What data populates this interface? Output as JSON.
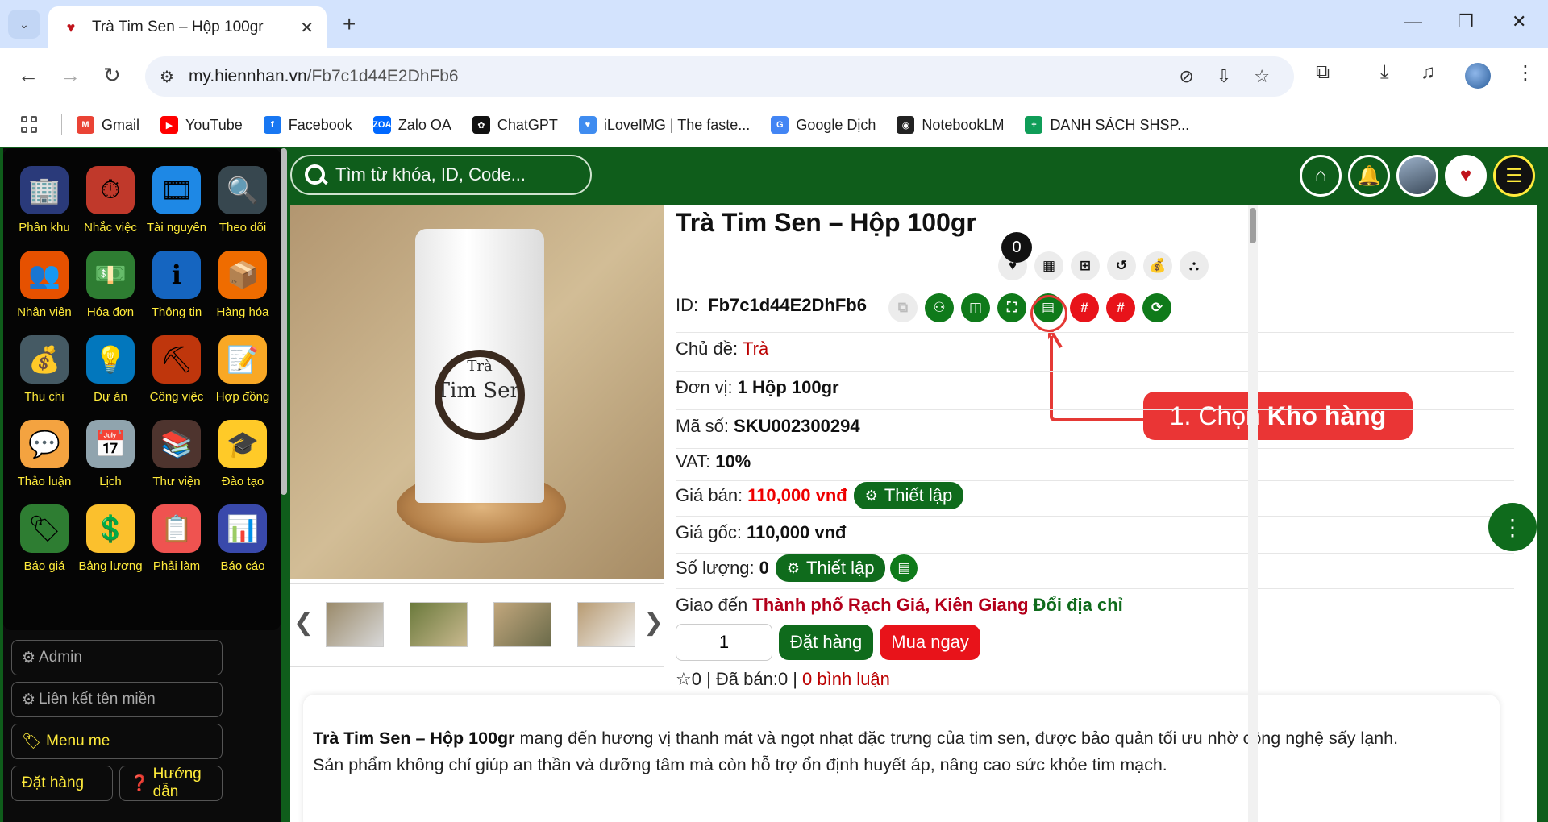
{
  "browser": {
    "tab_title": "Trà Tim Sen – Hộp 100gr",
    "url_domain": "my.hiennhan.vn",
    "url_path": "/Fb7c1d44E2DhFb6",
    "bookmarks": [
      {
        "label": "Gmail",
        "icon": "gmail-icon",
        "color": "#ea4335",
        "glyph": "M"
      },
      {
        "label": "YouTube",
        "icon": "youtube-icon",
        "color": "#ff0000",
        "glyph": "▶"
      },
      {
        "label": "Facebook",
        "icon": "facebook-icon",
        "color": "#1877f2",
        "glyph": "f"
      },
      {
        "label": "Zalo OA",
        "icon": "zalo-icon",
        "color": "#0068ff",
        "glyph": "ZOA"
      },
      {
        "label": "ChatGPT",
        "icon": "chatgpt-icon",
        "color": "#111111",
        "glyph": "✿"
      },
      {
        "label": "iLoveIMG | The faste...",
        "icon": "iloveimg-icon",
        "color": "#3f8cf0",
        "glyph": "♥"
      },
      {
        "label": "Google Dịch",
        "icon": "google-translate-icon",
        "color": "#4285f4",
        "glyph": "G"
      },
      {
        "label": "NotebookLM",
        "icon": "notebooklm-icon",
        "color": "#222222",
        "glyph": "◉"
      },
      {
        "label": "DANH SÁCH SHSP...",
        "icon": "google-sheets-icon",
        "color": "#0f9d58",
        "glyph": "+"
      }
    ]
  },
  "sidebar": {
    "items": [
      {
        "label": "Phân khu",
        "icon": "buildings-icon",
        "glyph": "🏢"
      },
      {
        "label": "Nhắc việc",
        "icon": "stopwatch-icon",
        "glyph": "⏱"
      },
      {
        "label": "Tài nguyên",
        "icon": "media-icon",
        "glyph": "🎞"
      },
      {
        "label": "Theo dõi",
        "icon": "monitor-icon",
        "glyph": "🔍"
      },
      {
        "label": "Nhân viên",
        "icon": "staff-icon",
        "glyph": "👥"
      },
      {
        "label": "Hóa đơn",
        "icon": "invoice-icon",
        "glyph": "💵"
      },
      {
        "label": "Thông tin",
        "icon": "info-icon",
        "glyph": "ℹ"
      },
      {
        "label": "Hàng hóa",
        "icon": "boxes-icon",
        "glyph": "📦"
      },
      {
        "label": "Thu chi",
        "icon": "cashflow-icon",
        "glyph": "💰"
      },
      {
        "label": "Dự án",
        "icon": "project-icon",
        "glyph": "💡"
      },
      {
        "label": "Công việc",
        "icon": "work-icon",
        "glyph": "⛏"
      },
      {
        "label": "Hợp đồng",
        "icon": "contract-icon",
        "glyph": "📝"
      },
      {
        "label": "Thảo luận",
        "icon": "chat-icon",
        "glyph": "💬"
      },
      {
        "label": "Lịch",
        "icon": "calendar-icon",
        "glyph": "📅"
      },
      {
        "label": "Thư viện",
        "icon": "library-icon",
        "glyph": "📚"
      },
      {
        "label": "Đào tạo",
        "icon": "training-icon",
        "glyph": "🎓"
      },
      {
        "label": "Báo giá",
        "icon": "price-tag-icon",
        "glyph": "🏷"
      },
      {
        "label": "Bảng lương",
        "icon": "salary-icon",
        "glyph": "💲"
      },
      {
        "label": "Phải làm",
        "icon": "todo-icon",
        "glyph": "📋"
      },
      {
        "label": "Báo cáo",
        "icon": "report-icon",
        "glyph": "📊"
      }
    ],
    "menu": {
      "admin": "Admin",
      "domain_link": "Liên kết tên miền",
      "menu_me": "Menu me",
      "order": "Đặt hàng",
      "guide": "Hướng dẫn"
    }
  },
  "search": {
    "placeholder": "Tìm từ khóa, ID, Code..."
  },
  "product": {
    "title": "Trà Tim Sen – Hộp 100gr",
    "favorite_count": "0",
    "id_label": "ID:",
    "id_value": "Fb7c1d44E2DhFb6",
    "topic_label": "Chủ đề:",
    "topic_value": "Trà",
    "unit_label": "Đơn vị:",
    "unit_value": "1 Hộp 100gr",
    "code_label": "Mã số:",
    "code_value": "SKU002300294",
    "vat_label": "VAT:",
    "vat_value": "10%",
    "price_label": "Giá bán:",
    "price_value": "110,000 vnđ",
    "setup_label": "Thiết lập",
    "cost_label": "Giá gốc:",
    "cost_value": "110,000 vnđ",
    "qty_label": "Số lượng:",
    "qty_value": "0",
    "ship_label": "Giao đến",
    "ship_value": "Thành phố Rạch Giá, Kiên Giang",
    "change_address": "Đổi địa chỉ",
    "order_qty": "1",
    "order_button": "Đặt hàng",
    "buy_now_button": "Mua ngay",
    "stats": "0 | Đã bán:0 |",
    "comments": "0 bình luận",
    "package_brand": "Trà",
    "package_name": "Tim Sen"
  },
  "callout": {
    "prefix": "1. Chọn",
    "bold": "Kho hàng"
  },
  "description": {
    "bold": "Trà Tim Sen – Hộp 100gr",
    "text": " mang đến hương vị thanh mát và ngọt nhạt đặc trưng của tim sen, được bảo quản tối ưu nhờ công nghệ sấy lạnh.",
    "text2": "Sản phẩm không chỉ giúp an thần và dưỡng tâm mà còn hỗ trợ ổn định huyết áp, nâng cao sức khỏe tim mạch."
  },
  "colors": {
    "brand_green": "#0f5d1b",
    "accent_red": "#e8131a",
    "sidebar_text": "#ffeb3b"
  }
}
